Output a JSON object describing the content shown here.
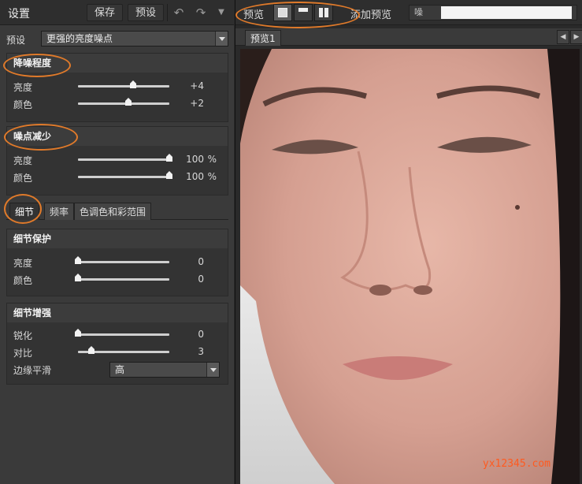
{
  "left_panel": {
    "title": "设置",
    "save_label": "保存",
    "preset_button_label": "预设",
    "undo_icon": "undo-icon",
    "redo_icon": "redo-icon",
    "menu_icon": "dropdown-menu-icon",
    "preset_row_label": "预设",
    "preset_value": "更强的亮度噪点"
  },
  "noise_reduction": {
    "title": "降噪程度",
    "brightness_label": "亮度",
    "brightness_value": "+4",
    "brightness_level": 0.6,
    "color_label": "颜色",
    "color_value": "+2",
    "color_level": 0.55
  },
  "speckle_reduction": {
    "title": "噪点减少",
    "brightness_label": "亮度",
    "brightness_value": "100",
    "brightness_unit": "%",
    "brightness_level": 1.0,
    "color_label": "颜色",
    "color_value": "100",
    "color_unit": "%",
    "color_level": 1.0
  },
  "tabs": [
    "细节",
    "频率",
    "色调色和彩范围"
  ],
  "detail_protection": {
    "title": "细节保护",
    "brightness_label": "亮度",
    "brightness_value": "0",
    "brightness_level": 0.0,
    "color_label": "颜色",
    "color_value": "0",
    "color_level": 0.0
  },
  "detail_enhance": {
    "title": "细节增强",
    "sharpen_label": "锐化",
    "sharpen_value": "0",
    "sharpen_level": 0.0,
    "contrast_label": "对比",
    "contrast_value": "3",
    "contrast_level": 0.15,
    "edge_label": "边缘平滑",
    "edge_value": "高"
  },
  "right_panel": {
    "preview_label": "预览",
    "add_preview_label": "添加预览",
    "blurred_text": "噪",
    "preview_tab": "预览1"
  },
  "watermark": "yx12345.com",
  "colors": {
    "highlight_ring": "#e07a2a",
    "watermark": "#ff5a1f"
  }
}
